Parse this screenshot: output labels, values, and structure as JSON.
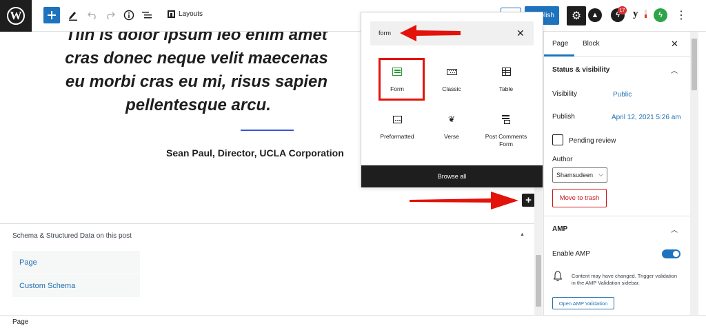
{
  "toolbar": {
    "layouts_label": "Layouts",
    "publish_label": "Publish",
    "notification_count": "17",
    "colors": {
      "accent": "#1e73be",
      "dark": "#1e1e1e"
    }
  },
  "editor": {
    "quote_lines": [
      "Tiin is dolor ipsum leo enim amet",
      "cras donec neque velit maecenas",
      "eu morbi cras eu mi, risus sapien",
      "pellentesque arcu."
    ],
    "citation": "Sean Paul, Director, UCLA Corporation"
  },
  "inserter": {
    "search_value": "form",
    "blocks": [
      {
        "label": "Form",
        "icon": "form-icon"
      },
      {
        "label": "Classic",
        "icon": "keyboard-icon"
      },
      {
        "label": "Table",
        "icon": "table-icon"
      },
      {
        "label": "Preformatted",
        "icon": "preformatted-icon"
      },
      {
        "label": "Verse",
        "icon": "feather-icon"
      },
      {
        "label": "Post Comments Form",
        "icon": "comments-form-icon"
      }
    ],
    "browse_all": "Browse all",
    "highlight_color": "#e3120b"
  },
  "schema": {
    "title": "Schema & Structured Data on this post",
    "tabs": [
      "Page",
      "Custom Schema"
    ]
  },
  "sidebar": {
    "tabs": [
      "Page",
      "Block"
    ],
    "status_section_title": "Status & visibility",
    "visibility_label": "Visibility",
    "visibility_value": "Public",
    "publish_label": "Publish",
    "publish_value": "April 12, 2021 5:26 am",
    "pending_review_label": "Pending review",
    "author_label": "Author",
    "author_value": "Shamsudeen",
    "move_to_trash": "Move to trash",
    "amp_section_title": "AMP",
    "enable_amp_label": "Enable AMP",
    "enable_amp_on": true,
    "amp_notice": "Content may have changed. Trigger validation in the AMP Validation sidebar.",
    "open_amp_validation": "Open AMP Validation"
  },
  "footer": {
    "breadcrumb": "Page"
  }
}
